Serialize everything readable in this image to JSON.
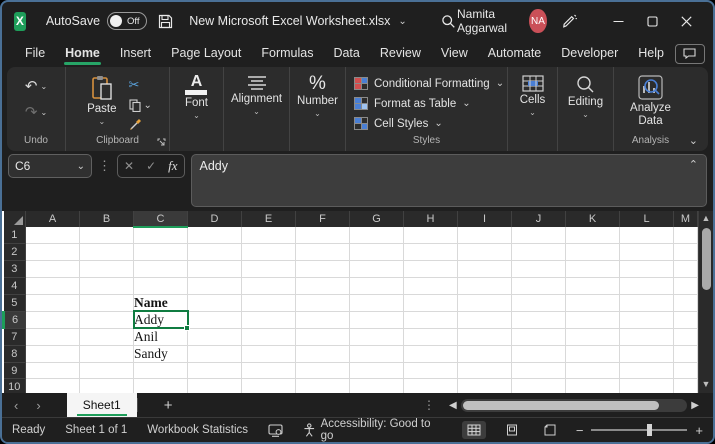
{
  "titlebar": {
    "autosave_label": "AutoSave",
    "autosave_state": "Off",
    "filename": "New Microsoft Excel Worksheet.xlsx",
    "user_name": "Namita Aggarwal",
    "user_initials": "NA"
  },
  "ribbon": {
    "tabs": [
      "File",
      "Home",
      "Insert",
      "Page Layout",
      "Formulas",
      "Data",
      "Review",
      "View",
      "Automate",
      "Developer",
      "Help"
    ],
    "active_tab": "Home",
    "undo": {
      "label": "Undo"
    },
    "clipboard": {
      "label": "Clipboard",
      "paste_label": "Paste"
    },
    "font": {
      "label": "Font"
    },
    "alignment": {
      "label": "Alignment"
    },
    "number": {
      "label": "Number"
    },
    "styles": {
      "label": "Styles",
      "items": [
        "Conditional Formatting",
        "Format as Table",
        "Cell Styles"
      ]
    },
    "cells": {
      "label": "Cells"
    },
    "editing": {
      "label": "Editing"
    },
    "analysis": {
      "label": "Analysis",
      "analyze_label": "Analyze Data"
    }
  },
  "formula_bar": {
    "name_box": "C6",
    "fx_label": "fx",
    "value": "Addy"
  },
  "grid": {
    "columns": [
      "A",
      "B",
      "C",
      "D",
      "E",
      "F",
      "G",
      "H",
      "I",
      "J",
      "K",
      "L",
      "M"
    ],
    "rows": [
      "1",
      "2",
      "3",
      "4",
      "5",
      "6",
      "7",
      "8",
      "9",
      "10"
    ],
    "selected_cell": "C6",
    "selected_column": "C",
    "selected_row": "6",
    "cells": [
      {
        "col": "C",
        "row": "5",
        "value": "Name",
        "bold": true
      },
      {
        "col": "C",
        "row": "6",
        "value": "Addy",
        "bold": false
      },
      {
        "col": "C",
        "row": "7",
        "value": "Anil",
        "bold": false
      },
      {
        "col": "C",
        "row": "8",
        "value": "Sandy",
        "bold": false
      }
    ]
  },
  "sheet_bar": {
    "tabs": [
      "Sheet1"
    ],
    "active_tab": "Sheet1"
  },
  "status_bar": {
    "mode": "Ready",
    "sheet_info": "Sheet 1 of 1",
    "workbook_statistics": "Workbook Statistics",
    "accessibility": "Accessibility: Good to go"
  },
  "colors": {
    "accent_green": "#1e9e5a",
    "selection_green": "#107c41",
    "share_green": "#1f9e58",
    "avatar_red": "#ca5058"
  }
}
